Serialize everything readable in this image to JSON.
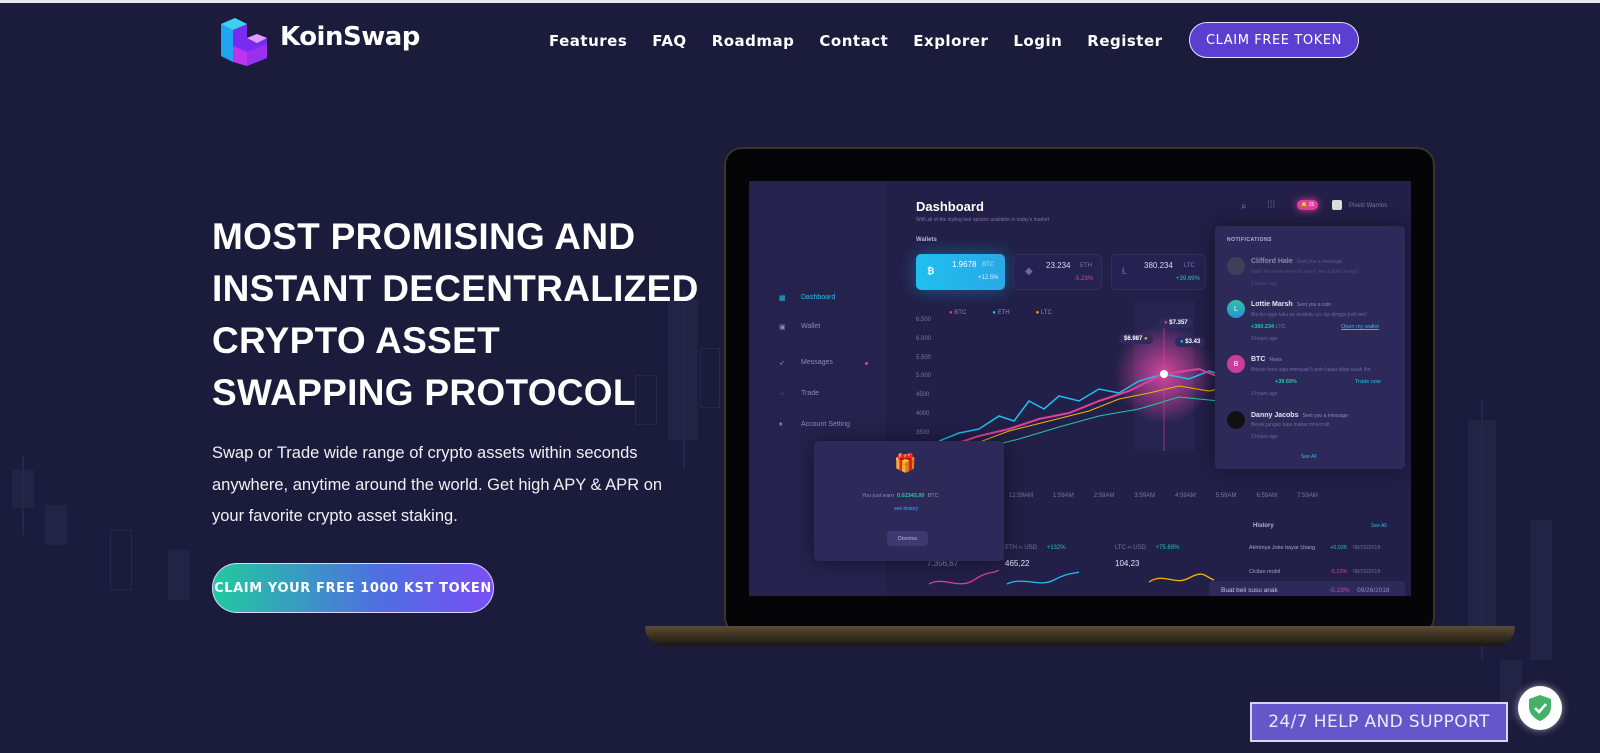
{
  "brand": {
    "name": "KoinSwap",
    "logo": "cube-logo"
  },
  "nav": {
    "items": [
      "Features",
      "FAQ",
      "Roadmap",
      "Contact",
      "Explorer",
      "Login",
      "Register"
    ],
    "cta": "CLAIM FREE TOKEN"
  },
  "hero": {
    "title_lines": [
      "MOST PROMISING AND",
      "INSTANT DECENTRALIZED",
      "CRYPTO ASSET",
      "SWAPPING PROTOCOL"
    ],
    "description": "Swap or Trade wide range of crypto assets within seconds anywhere, anytime around the world. Get high APY & APR on your favorite crypto asset staking.",
    "cta": "CLAIM YOUR FREE 1000 KST TOKEN"
  },
  "dashboard": {
    "title": "Dashboard",
    "subtitle": "With all of the styling tool options available in today's market",
    "sidebar": [
      "Dashboard",
      "Wallet",
      "Messages",
      "Trade",
      "Account Setting"
    ],
    "badge": "15",
    "user": "Pixelz Warrios",
    "wallets_label": "Wallets",
    "wallets": [
      {
        "value": "1.9678",
        "coin": "BTC",
        "change": "+12.5%"
      },
      {
        "value": "23.234",
        "coin": "ETH",
        "change": "-5.23%"
      },
      {
        "value": "380.234",
        "coin": "LTC",
        "change": "+39.69%"
      }
    ],
    "legend": [
      "BTC",
      "ETH",
      "LTC"
    ],
    "y_ticks": [
      "6.500",
      "6.000",
      "5.500",
      "5.000",
      "4500",
      "4000",
      "3500"
    ],
    "x_ticks": [
      "12:59AM",
      "1:59AM",
      "2:59AM",
      "3:59AM",
      "4:59AM",
      "5:59AM",
      "6:59AM",
      "7:59AM"
    ],
    "tooltips": [
      "$7.357",
      "$6.987",
      "$3.43"
    ],
    "notifications_label": "NOTIFICATIONS",
    "notifications": [
      {
        "name": "Clifford Hale",
        "action": "Sent you a message",
        "msg": "Hallo bro anak wes pro saiki? wes kuliah urung?...",
        "time": "2 hours ago"
      },
      {
        "name": "Lottie Marsh",
        "action": "Sent you a coin",
        "msg": "Bro iki nggo tuku es anakmu yo, ojo dinggo judi nen!",
        "amount": "+380.234",
        "coin": "LTC",
        "link": "Open my wallet",
        "time": "3 hours ago"
      },
      {
        "name": "BTC",
        "action": "News",
        "msg": "Bitcoin baru saja menguat 5 poin kalau tidak salah lho",
        "change": "+39.69%",
        "link": "Trade now",
        "time": "3 hours ago"
      },
      {
        "name": "Danny Jacobs",
        "action": "Sent you a message",
        "msg": "Besok jangan lupa mabar minecraft",
        "time": "2 hours ago"
      }
    ],
    "see_all": "See All",
    "earn": {
      "text": "You just earn",
      "amount": "0.02343,00",
      "coin": "BTC",
      "link": "see history",
      "button": "Dismiss"
    },
    "pairs": [
      {
        "value": "7.356,67"
      },
      {
        "base": "ETH",
        "quote": "USD",
        "change": "+132%",
        "value": "465,22"
      },
      {
        "base": "LTC",
        "quote": "USD",
        "change": "+75.69%",
        "value": "104,23"
      }
    ],
    "history_label": "History",
    "history_see_all": "See All",
    "history": [
      {
        "title": "Akhirnya Joke bayar Utang",
        "change": "+0.025",
        "date": "08/26/2018"
      },
      {
        "title": "Cicilan mobil",
        "change": "-5.23%",
        "date": "08/26/2018"
      },
      {
        "title": "Buat beli susu anak",
        "change": "-5.23%",
        "date": "08/26/2018"
      }
    ]
  },
  "support": {
    "label": "24/7 HELP AND SUPPORT"
  },
  "colors": {
    "background": "#1b1b3b",
    "accent": "#5a3fd0",
    "cyan": "#1ec0ef",
    "pink": "#e0409a",
    "green": "#22c9a0"
  }
}
